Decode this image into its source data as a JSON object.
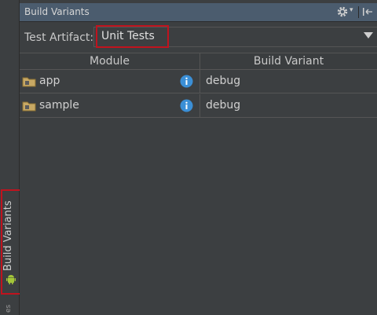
{
  "panel": {
    "title": "Build Variants",
    "test_artifact_label": "Test Artifact:",
    "test_artifact_value": "Unit Tests"
  },
  "table": {
    "columns": [
      "Module",
      "Build Variant"
    ],
    "rows": [
      {
        "module": "app",
        "variant": "debug"
      },
      {
        "module": "sample",
        "variant": "debug"
      }
    ]
  },
  "sidebar": {
    "tab_label": "Build Variants",
    "bottom_label": "es"
  },
  "colors": {
    "highlight": "#c0131e",
    "titlebar": "#4b5c6e",
    "info": "#3b8fd6"
  }
}
